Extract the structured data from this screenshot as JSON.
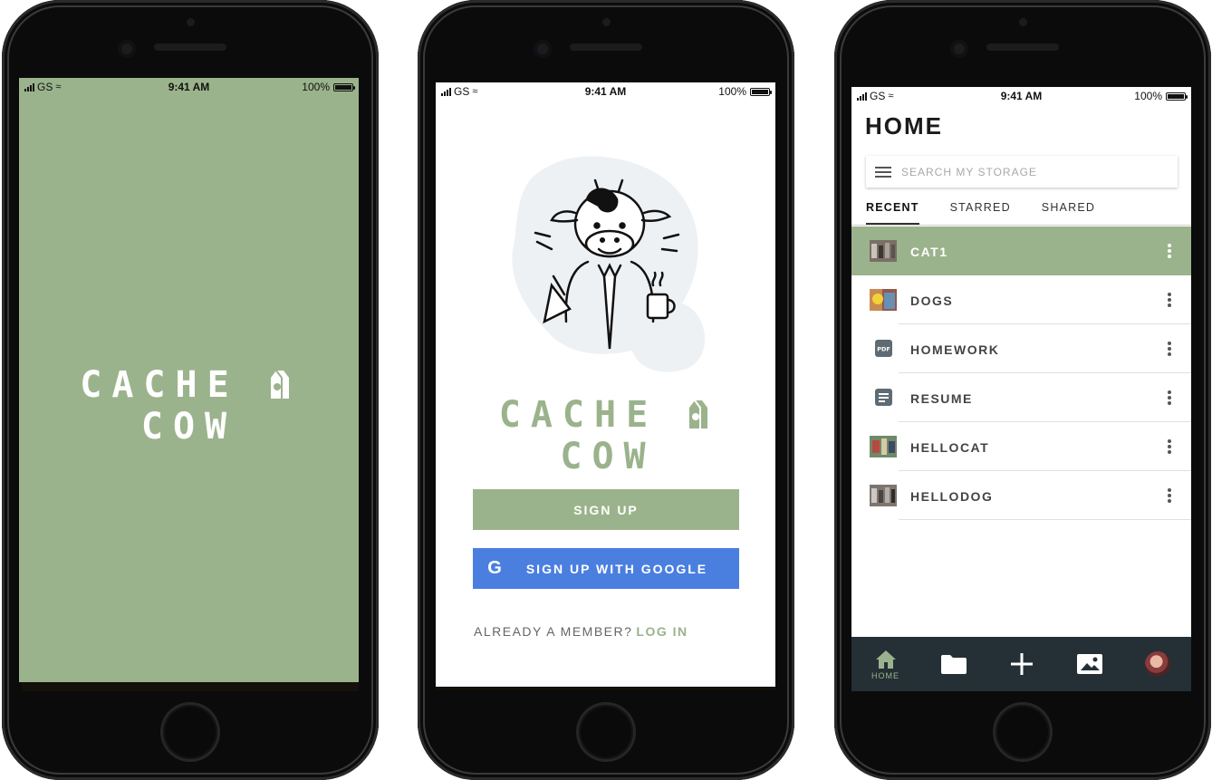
{
  "status_bar": {
    "carrier": "GS",
    "time": "9:41 AM",
    "battery": "100%"
  },
  "brand": {
    "name_left": "CACHE",
    "name_right": "COW",
    "accent": "#9bb38c"
  },
  "splash": {
    "background": "#9bb38c"
  },
  "login": {
    "signup_label": "SIGN UP",
    "google_label": "SIGN UP WITH GOOGLE",
    "google_glyph": "G",
    "member_prompt": "ALREADY A MEMBER?",
    "login_link": "LOG IN"
  },
  "home": {
    "title": "HOME",
    "search_placeholder": "SEARCH MY STORAGE",
    "tabs": [
      {
        "label": "RECENT",
        "active": true
      },
      {
        "label": "STARRED",
        "active": false
      },
      {
        "label": "SHARED",
        "active": false
      }
    ],
    "files": [
      {
        "name": "CAT1",
        "type": "photo",
        "selected": true
      },
      {
        "name": "DOGS",
        "type": "photo",
        "selected": false
      },
      {
        "name": "HOMEWORK",
        "type": "pdf",
        "selected": false
      },
      {
        "name": "RESUME",
        "type": "document",
        "selected": false
      },
      {
        "name": "HELLOCAT",
        "type": "photo",
        "selected": false
      },
      {
        "name": "HELLODOG",
        "type": "photo",
        "selected": false
      }
    ],
    "pdf_badge": "PDF",
    "nav": {
      "home_label": "HOME",
      "items": [
        "home-icon",
        "folder-icon",
        "add-icon",
        "image-icon",
        "profile-avatar"
      ]
    }
  }
}
